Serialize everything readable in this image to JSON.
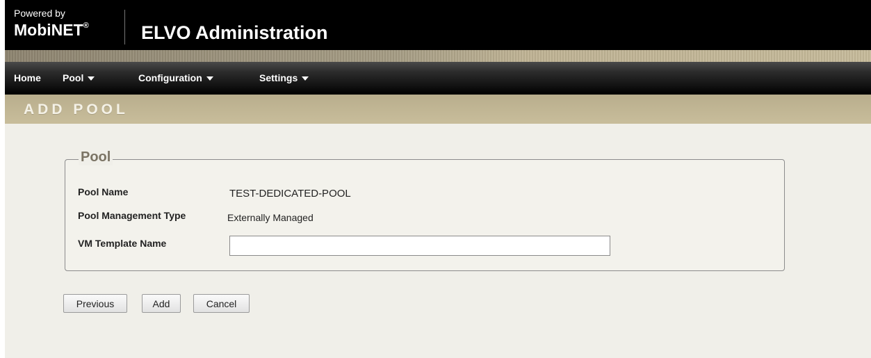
{
  "header": {
    "powered_by": "Powered by",
    "brand": "MobiNET",
    "brand_mark": "®",
    "app_title": "ELVO Administration"
  },
  "nav": {
    "items": [
      {
        "label": "Home",
        "has_dropdown": false
      },
      {
        "label": "Pool",
        "has_dropdown": true
      },
      {
        "label": "Configuration",
        "has_dropdown": true
      },
      {
        "label": "Settings",
        "has_dropdown": true
      }
    ]
  },
  "page": {
    "title": "ADD POOL"
  },
  "pool_section": {
    "legend": "Pool",
    "fields": [
      {
        "label": "Pool Name",
        "value": "TEST-DEDICATED-POOL"
      },
      {
        "label": "Pool Management Type",
        "value": "Externally Managed"
      },
      {
        "label": "VM Template Name",
        "value": "",
        "placeholder": ""
      }
    ]
  },
  "buttons": {
    "previous": "Previous",
    "add": "Add",
    "cancel": "Cancel"
  },
  "colors": {
    "header_bg": "#000000",
    "accent_tan": "#c1b593",
    "content_bg": "#f0efe9",
    "legend_text": "#7b7465"
  }
}
